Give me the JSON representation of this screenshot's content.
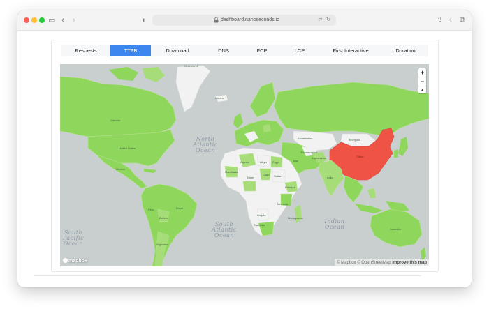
{
  "browser": {
    "url": "dashboard.nanoseconds.io",
    "nav_icons": [
      "sidebar-icon",
      "back-icon",
      "forward-icon"
    ],
    "right_icons": [
      "share-icon",
      "new-tab-icon",
      "tabs-overview-icon"
    ]
  },
  "tabs": [
    {
      "label": "Resuests",
      "active": false
    },
    {
      "label": "TTFB",
      "active": true
    },
    {
      "label": "Download",
      "active": false
    },
    {
      "label": "DNS",
      "active": false
    },
    {
      "label": "FCP",
      "active": false
    },
    {
      "label": "LCP",
      "active": false
    },
    {
      "label": "First Interactive",
      "active": false
    },
    {
      "label": "Duration",
      "active": false
    }
  ],
  "colors": {
    "active_tab": "#3e86ef",
    "good": "#8fd65c",
    "mid": "#a7dd79",
    "poor": "#ee5346",
    "no_data": "#f2f2f2",
    "ocean": "#c9cfcf"
  },
  "map": {
    "zoom_in": "+",
    "zoom_out": "−",
    "compass": "▲",
    "logo": "mapbox",
    "attribution_prefix": "© Mapbox © OpenStreetMap",
    "attribution_link": "Improve this map",
    "oceans": [
      "North Atlantic Ocean",
      "South Atlantic Ocean",
      "South Pacific Ocean",
      "Indian Ocean"
    ],
    "country_labels": [
      "Greenland",
      "Iceland",
      "United States",
      "Canada",
      "Mexico",
      "Brazil",
      "Peru",
      "Bolivia",
      "Argentina",
      "Algeria",
      "Libya",
      "Egypt",
      "Niger",
      "Mauritania",
      "Chad",
      "Sudan",
      "Ethiopia",
      "Tanzania",
      "Angola",
      "Namibia",
      "Madagascar",
      "Kazakhstan",
      "Mongolia",
      "China",
      "Afghanistan",
      "India",
      "Iran",
      "Australia",
      "Turkmenistan"
    ]
  }
}
